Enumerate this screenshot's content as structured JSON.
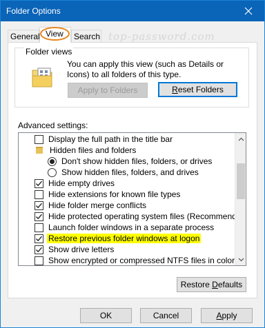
{
  "window": {
    "title": "Folder Options"
  },
  "tabs": [
    {
      "label": "General"
    },
    {
      "label": "View"
    },
    {
      "label": "Search"
    }
  ],
  "watermark": "top-password.com",
  "folder_views": {
    "legend": "Folder views",
    "description": "You can apply this view (such as Details or Icons) to all folders of this type.",
    "apply_label": "Apply to Folders",
    "reset_label_underlined": "R",
    "reset_label_rest": "eset Folders"
  },
  "advanced": {
    "label": "Advanced settings:",
    "items": [
      {
        "type": "checkbox",
        "checked": false,
        "label": "Display the full path in the title bar"
      },
      {
        "type": "folder",
        "label": "Hidden files and folders"
      },
      {
        "type": "radio",
        "checked": true,
        "label": "Don't show hidden files, folders, or drives"
      },
      {
        "type": "radio",
        "checked": false,
        "label": "Show hidden files, folders, and drives"
      },
      {
        "type": "checkbox",
        "checked": true,
        "label": "Hide empty drives"
      },
      {
        "type": "checkbox",
        "checked": false,
        "label": "Hide extensions for known file types"
      },
      {
        "type": "checkbox",
        "checked": true,
        "label": "Hide folder merge conflicts"
      },
      {
        "type": "checkbox",
        "checked": true,
        "label": "Hide protected operating system files (Recommended)"
      },
      {
        "type": "checkbox",
        "checked": false,
        "label": "Launch folder windows in a separate process"
      },
      {
        "type": "checkbox",
        "checked": true,
        "label": "Restore previous folder windows at logon",
        "highlight": true
      },
      {
        "type": "checkbox",
        "checked": true,
        "label": "Show drive letters"
      },
      {
        "type": "checkbox",
        "checked": false,
        "label": "Show encrypted or compressed NTFS files in color"
      }
    ]
  },
  "buttons": {
    "restore_defaults_prefix": "Restore ",
    "restore_defaults_underlined": "D",
    "restore_defaults_rest": "efaults",
    "ok": "OK",
    "cancel": "Cancel",
    "apply_underlined": "A",
    "apply_rest": "pply"
  },
  "colors": {
    "titlebar": "#0a64b8",
    "focus_ring": "#e8861f",
    "highlight": "#ffff00",
    "accent_border": "#0078d7"
  },
  "icons": {
    "close": "close-icon",
    "folder_views": "folder-views-icon",
    "check": "checkmark-icon",
    "scroll_up": "chevron-up-icon",
    "scroll_down": "chevron-down-icon"
  }
}
